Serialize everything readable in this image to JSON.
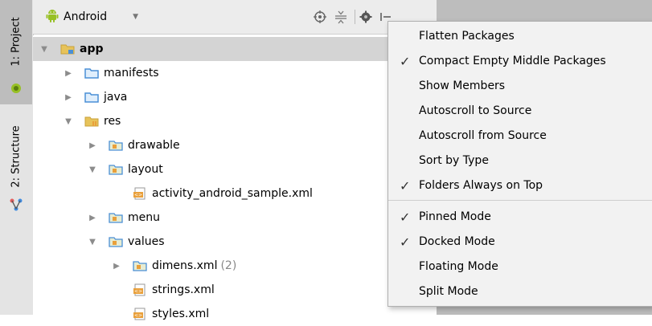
{
  "tool_strip": {
    "project_tab": "1: Project",
    "structure_tab": "2: Structure"
  },
  "header": {
    "view_selector": "Android"
  },
  "tree": [
    {
      "label": "app",
      "depth": 0,
      "arrow": "▼",
      "icon": "module-folder-icon",
      "bold": true
    },
    {
      "label": "manifests",
      "depth": 1,
      "arrow": "▶",
      "icon": "folder-icon"
    },
    {
      "label": "java",
      "depth": 1,
      "arrow": "▶",
      "icon": "folder-icon"
    },
    {
      "label": "res",
      "depth": 1,
      "arrow": "▼",
      "icon": "res-folder-icon"
    },
    {
      "label": "drawable",
      "depth": 2,
      "arrow": "▶",
      "icon": "res-subfolder-icon"
    },
    {
      "label": "layout",
      "depth": 2,
      "arrow": "▼",
      "icon": "res-subfolder-icon"
    },
    {
      "label": "activity_android_sample.xml",
      "depth": 3,
      "arrow": "",
      "icon": "xml-file-icon"
    },
    {
      "label": "menu",
      "depth": 2,
      "arrow": "▶",
      "icon": "res-subfolder-icon"
    },
    {
      "label": "values",
      "depth": 2,
      "arrow": "▼",
      "icon": "res-subfolder-icon"
    },
    {
      "label": "dimens.xml",
      "count": "(2)",
      "depth": 3,
      "arrow": "▶",
      "icon": "res-subfolder-icon"
    },
    {
      "label": "strings.xml",
      "depth": 3,
      "arrow": "",
      "icon": "xml-file-icon"
    },
    {
      "label": "styles.xml",
      "depth": 3,
      "arrow": "",
      "icon": "xml-file-icon"
    }
  ],
  "menu": {
    "items": [
      {
        "label": "Flatten Packages",
        "checked": false
      },
      {
        "label": "Compact Empty Middle Packages",
        "checked": true
      },
      {
        "label": "Show Members",
        "checked": false
      },
      {
        "label": "Autoscroll to Source",
        "checked": false
      },
      {
        "label": "Autoscroll from Source",
        "checked": false
      },
      {
        "label": "Sort by Type",
        "checked": false
      },
      {
        "label": "Folders Always on Top",
        "checked": true
      },
      {
        "label": "Pinned Mode",
        "checked": true
      },
      {
        "label": "Docked Mode",
        "checked": true
      },
      {
        "label": "Floating Mode",
        "checked": false
      },
      {
        "label": "Split Mode",
        "checked": false
      }
    ],
    "check_glyph": "✓"
  },
  "colors": {
    "folder_blue": "#4a8fd6",
    "res_orange": "#e9a03b",
    "android_green": "#97c024"
  }
}
